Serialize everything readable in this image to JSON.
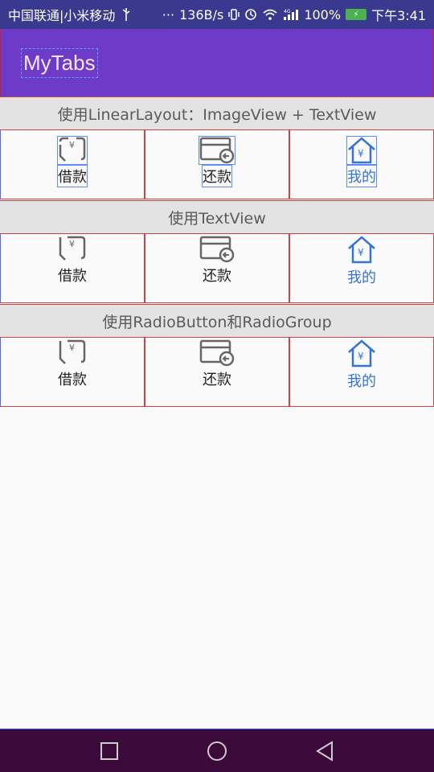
{
  "status": {
    "carrier": "中国联通|小米移动",
    "usb_icon": "usb-icon",
    "more": "···",
    "speed": "136B/s",
    "vibrate_icon": "vibrate-icon",
    "alarm_icon": "alarm-icon",
    "wifi_icon": "wifi-icon",
    "signal_label": "4G",
    "battery_percent": "100%",
    "time": "下午3:41"
  },
  "app": {
    "title": "MyTabs",
    "accent": "#6d3bc7"
  },
  "sections": [
    {
      "title": "使用LinearLayout：ImageView + TextView",
      "tabs": [
        {
          "label": "借款",
          "icon": "borrow-icon",
          "selected": false
        },
        {
          "label": "还款",
          "icon": "repay-icon",
          "selected": false
        },
        {
          "label": "我的",
          "icon": "home-icon",
          "selected": true
        }
      ]
    },
    {
      "title": "使用TextView",
      "tabs": [
        {
          "label": "借款",
          "icon": "borrow-icon",
          "selected": false
        },
        {
          "label": "还款",
          "icon": "repay-icon",
          "selected": false
        },
        {
          "label": "我的",
          "icon": "home-icon",
          "selected": true
        }
      ]
    },
    {
      "title": "使用RadioButton和RadioGroup",
      "tabs": [
        {
          "label": "借款",
          "icon": "borrow-icon",
          "selected": false
        },
        {
          "label": "还款",
          "icon": "repay-icon",
          "selected": false
        },
        {
          "label": "我的",
          "icon": "home-icon",
          "selected": true
        }
      ]
    }
  ],
  "nav": {
    "recent_icon": "square-recents-icon",
    "home_icon": "circle-home-icon",
    "back_icon": "triangle-back-icon"
  },
  "colors": {
    "selected_tab": "#3574d6",
    "unselected_icon": "#666666"
  }
}
